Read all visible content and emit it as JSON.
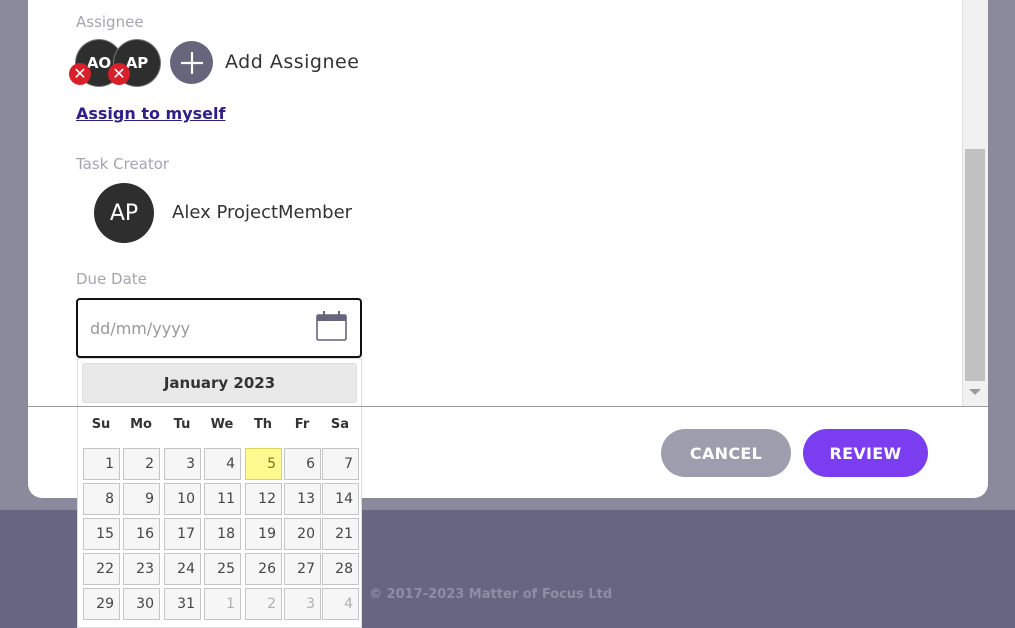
{
  "assignee": {
    "label": "Assignee",
    "avatars": [
      {
        "initials": "AO"
      },
      {
        "initials": "AP"
      }
    ],
    "remove_glyph": "✕",
    "add_label": "Add Assignee",
    "add_icon": "plus-icon",
    "assign_self_link": "Assign to myself"
  },
  "creator": {
    "label": "Task Creator",
    "initials": "AP",
    "name": "Alex ProjectMember"
  },
  "due_date": {
    "label": "Due Date",
    "placeholder": "dd/mm/yyyy",
    "icon": "calendar-icon"
  },
  "datepicker": {
    "month_title": "January 2023",
    "weekdays": [
      "Su",
      "Mo",
      "Tu",
      "We",
      "Th",
      "Fr",
      "Sa"
    ],
    "today": 5,
    "weeks": [
      [
        1,
        2,
        3,
        4,
        5,
        6,
        7
      ],
      [
        8,
        9,
        10,
        11,
        12,
        13,
        14
      ],
      [
        15,
        16,
        17,
        18,
        19,
        20,
        21
      ],
      [
        22,
        23,
        24,
        25,
        26,
        27,
        28
      ],
      [
        29,
        30,
        31,
        1,
        2,
        3,
        4
      ]
    ],
    "other_month_flags": [
      [
        false,
        false,
        false,
        false,
        false,
        false,
        false
      ],
      [
        false,
        false,
        false,
        false,
        false,
        false,
        false
      ],
      [
        false,
        false,
        false,
        false,
        false,
        false,
        false
      ],
      [
        false,
        false,
        false,
        false,
        false,
        false,
        false
      ],
      [
        false,
        false,
        false,
        true,
        true,
        true,
        true
      ]
    ]
  },
  "actions": {
    "cancel": "CANCEL",
    "review": "REVIEW"
  },
  "footer": {
    "copyright": "© 2017-2023 Matter of Focus Ltd"
  },
  "colors": {
    "primary": "#7a3df0",
    "secondary": "#9d9dae",
    "remove": "#d8202a",
    "today": "#fffa90"
  }
}
